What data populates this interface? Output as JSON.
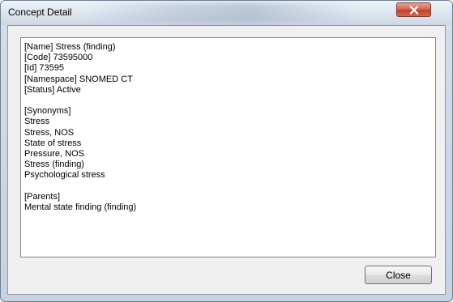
{
  "window": {
    "title": "Concept Detail",
    "close_icon": "close-x-icon"
  },
  "detail": {
    "lines": [
      "[Name] Stress (finding)",
      "[Code] 73595000",
      "[Id] 73595",
      "[Namespace] SNOMED CT",
      "[Status] Active",
      "",
      "[Synonyms]",
      "Stress",
      "Stress, NOS",
      "State of stress",
      "Pressure, NOS",
      "Stress (finding)",
      "Psychological stress",
      "",
      "[Parents]",
      "Mental state finding (finding)"
    ]
  },
  "buttons": {
    "close_label": "Close"
  }
}
